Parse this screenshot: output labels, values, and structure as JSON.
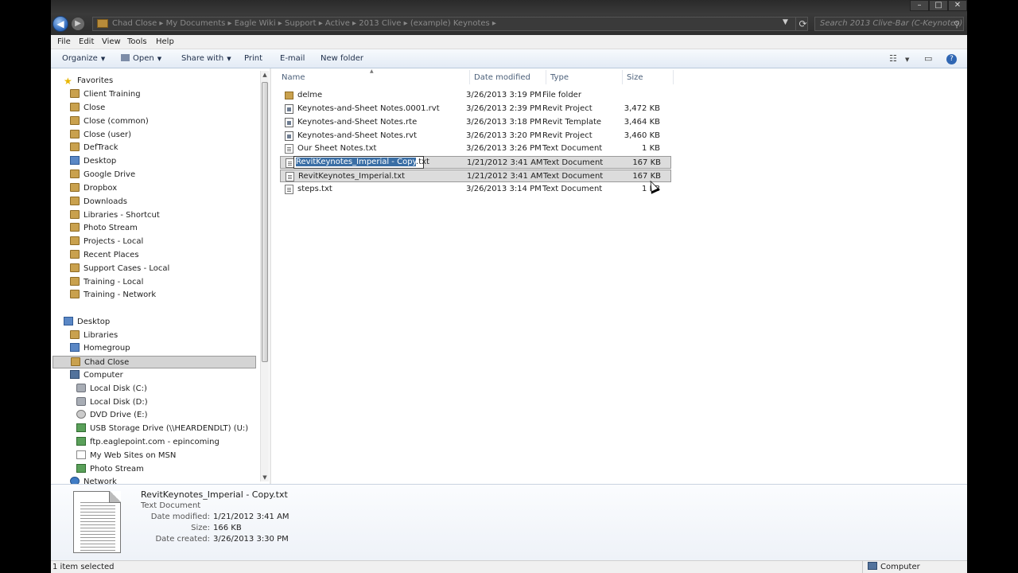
{
  "address": {
    "path": "Chad Close  ▸  My Documents  ▸  Eagle Wiki  ▸  Support  ▸  Active  ▸  2013 Clive  ▸  (example) Keynotes  ▸",
    "search_placeholder": "Search 2013 Clive-Bar (C-Keynotes)"
  },
  "menu": [
    "File",
    "Edit",
    "View",
    "Tools",
    "Help"
  ],
  "toolbar": {
    "organize": "Organize",
    "open": "Open",
    "share": "Share with",
    "print": "Print",
    "email": "E-mail",
    "new_folder": "New folder"
  },
  "nav": {
    "favorites_label": "Favorites",
    "favorites": [
      "Client Training",
      "Close",
      "Close (common)",
      "Close (user)",
      "DefTrack",
      "Desktop",
      "Google Drive",
      "Dropbox",
      "Downloads",
      "Libraries - Shortcut",
      "Photo Stream",
      "Projects - Local",
      "Recent Places",
      "Support Cases - Local",
      "Training - Local",
      "Training - Network"
    ],
    "desktop_label": "Desktop",
    "desktop_items": [
      "Libraries",
      "Homegroup",
      "Chad Close",
      "Computer"
    ],
    "computer_items": [
      "Local Disk (C:)",
      "Local Disk (D:)",
      "DVD Drive (E:)",
      "USB Storage Drive (\\\\HEARDENDLT) (U:)",
      "ftp.eaglepoint.com - epincoming",
      "My Web Sites on MSN",
      "Photo Stream"
    ],
    "network_label": "Network"
  },
  "columns": {
    "name": "Name",
    "date": "Date modified",
    "type": "Type",
    "size": "Size"
  },
  "files": [
    {
      "name": "delme",
      "date": "3/26/2013 3:19 PM",
      "type": "File folder",
      "size": "",
      "icon": "folder-icon"
    },
    {
      "name": "Keynotes-and-Sheet Notes.0001.rvt",
      "date": "3/26/2013 2:39 PM",
      "type": "Revit Project",
      "size": "3,472 KB",
      "icon": "revit-file-icon"
    },
    {
      "name": "Keynotes-and-Sheet Notes.rte",
      "date": "3/26/2013 3:18 PM",
      "type": "Revit Template",
      "size": "3,464 KB",
      "icon": "revit-file-icon"
    },
    {
      "name": "Keynotes-and-Sheet Notes.rvt",
      "date": "3/26/2013 3:20 PM",
      "type": "Revit Project",
      "size": "3,460 KB",
      "icon": "revit-file-icon"
    },
    {
      "name": "Our Sheet Notes.txt",
      "date": "3/26/2013 3:26 PM",
      "type": "Text Document",
      "size": "1 KB",
      "icon": "text-file-icon"
    },
    {
      "name": "RevitKeynotes_Imperial - Copy.txt",
      "name_selected_part": "RevitKeynotes_Imperial - Copy",
      "name_ext": ".txt",
      "date": "1/21/2012 3:41 AM",
      "type": "Text Document",
      "size": "167 KB",
      "icon": "text-file-icon"
    },
    {
      "name": "RevitKeynotes_Imperial.txt",
      "date": "1/21/2012 3:41 AM",
      "type": "Text Document",
      "size": "167 KB",
      "icon": "text-file-icon"
    },
    {
      "name": "steps.txt",
      "date": "3/26/2013 3:14 PM",
      "type": "Text Document",
      "size": "1 KB",
      "icon": "text-file-icon"
    }
  ],
  "details": {
    "name": "RevitKeynotes_Imperial - Copy.txt",
    "type": "Text Document",
    "date_modified_label": "Date modified:",
    "date_modified": "1/21/2012 3:41 AM",
    "size_label": "Size:",
    "size": "166 KB",
    "date_created_label": "Date created:",
    "date_created": "3/26/2013 3:30 PM"
  },
  "status": {
    "left": "1 item selected",
    "right": "Computer"
  }
}
